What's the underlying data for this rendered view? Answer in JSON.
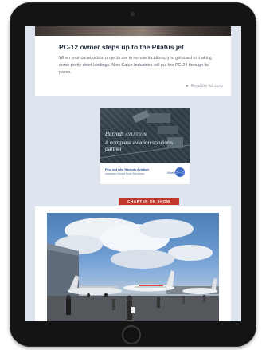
{
  "article": {
    "title": "PC-12 owner steps up to the Pilatus jet",
    "body": "When your construction projects are in remote locations, you get used to making some pretty short landings. Now Cajun Industries will put the PC-24 through its paces.",
    "read_more": "Read the full story",
    "read_more_icon": "arrow-right-icon"
  },
  "ad": {
    "brand": "Harrods",
    "brand_sub": "AVIATION",
    "tagline": "A complete aviation solutions partner",
    "footer_line1": "Find out why Harrods Aviation",
    "footer_line2": "chooses World Fuel Services",
    "partner_logo": "World"
  },
  "section_label": "CHARTER ON SHOW",
  "colors": {
    "badge": "#c0392b",
    "page_bg": "#dfe5ee",
    "title": "#1d2a3a"
  }
}
